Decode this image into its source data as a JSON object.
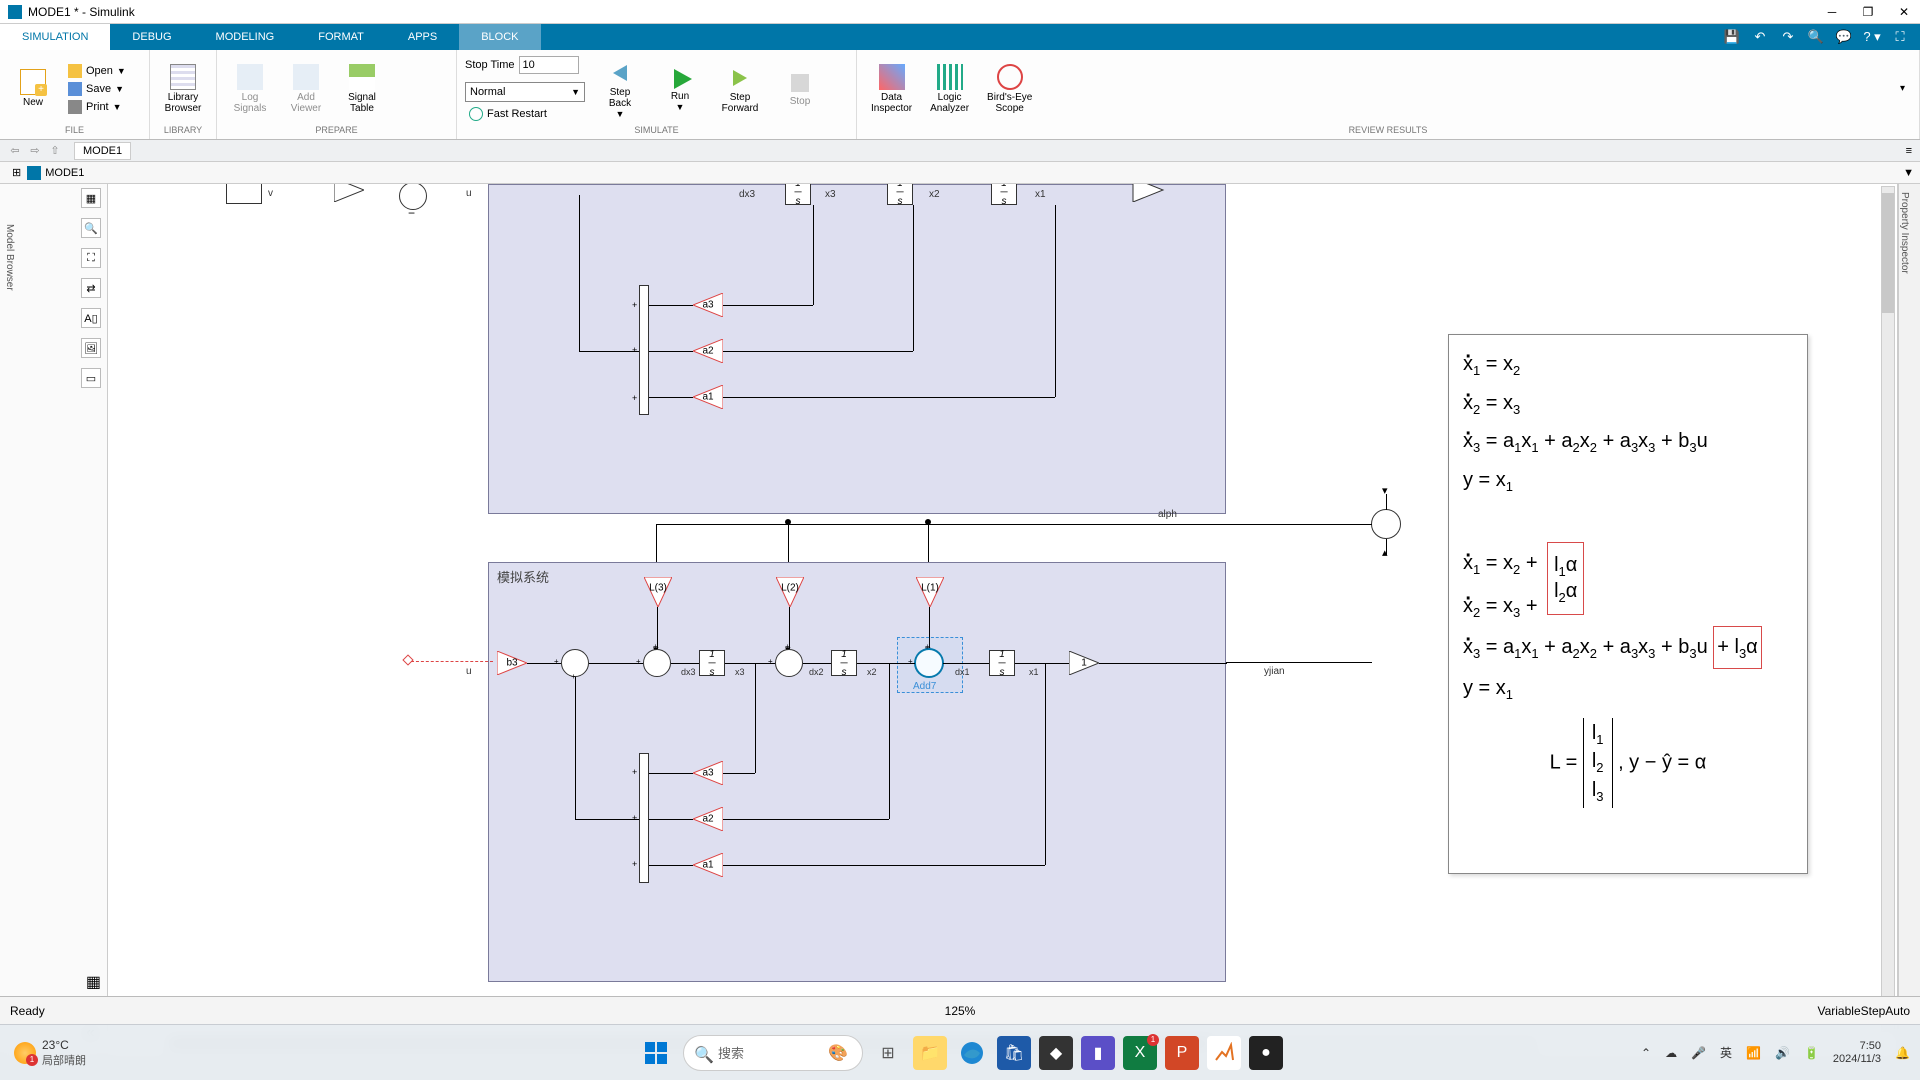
{
  "window": {
    "title": "MODE1 * - Simulink"
  },
  "tabs": {
    "simulation": "SIMULATION",
    "debug": "DEBUG",
    "modeling": "MODELING",
    "format": "FORMAT",
    "apps": "APPS",
    "block": "BLOCK"
  },
  "toolstrip": {
    "new": "New",
    "open": "Open",
    "save": "Save",
    "print": "Print",
    "library_browser": "Library\nBrowser",
    "log_signals": "Log\nSignals",
    "add_viewer": "Add\nViewer",
    "signal_table": "Signal\nTable",
    "stop_time_label": "Stop Time",
    "stop_time_value": "10",
    "mode": "Normal",
    "fast_restart": "Fast Restart",
    "step_back": "Step\nBack",
    "run": "Run",
    "step_forward": "Step\nForward",
    "stop": "Stop",
    "data_inspector": "Data\nInspector",
    "logic_analyzer": "Logic\nAnalyzer",
    "birds_eye": "Bird's-Eye\nScope",
    "groups": {
      "file": "FILE",
      "library": "LIBRARY",
      "prepare": "PREPARE",
      "simulate": "SIMULATE",
      "review": "REVIEW RESULTS"
    }
  },
  "explorer": {
    "model": "MODE1"
  },
  "tab_current": "MODE1",
  "sidebar_label": "Model Browser",
  "right_panel": "Property Inspector",
  "canvas": {
    "subsystem2_label": "模拟系统",
    "gains": {
      "b3": "b3",
      "a1": "a1",
      "a2": "a2",
      "a3": "a3",
      "L1": "L(1)",
      "L2": "L(2)",
      "L3": "L(3)",
      "one": "1"
    },
    "signals": {
      "u": "u",
      "v": "v",
      "dx3": "dx3",
      "x3": "x3",
      "dx2": "dx2",
      "x2": "x2",
      "dx1": "dx1",
      "x1": "x1",
      "alph": "alph",
      "yjian": "yjian"
    },
    "selected_block": "Add7",
    "integrator_sym": "1/s"
  },
  "annotation": {
    "eq1": "ẋ₁ = x₂",
    "eq2": "ẋ₂ = x₃",
    "eq3": "ẋ₃ = a₁x₁ + a₂x₂ + a₃x₃ + b₃u",
    "eq4": "y = x₁",
    "eq5a": "ẋ₁ = x₂ +",
    "eq5b": "l₁α",
    "eq6a": "ẋ₂ = x₃ +",
    "eq6b": "l₂α",
    "eq7a": "ẋ₃ = a₁x₁ + a₂x₂ + a₃x₃ + b₃u",
    "eq7b": "+ l₃α",
    "eq8": "y = x₁",
    "matL": "L =",
    "mat1": "l₁",
    "mat2": "l₂",
    "mat3": "l₃",
    "matR": ", y − ŷ = α"
  },
  "status": {
    "ready": "Ready",
    "zoom": "125%",
    "solver": "VariableStepAuto"
  },
  "taskbar": {
    "search_placeholder": "搜索",
    "temp": "23°C",
    "weather_desc": "局部晴朗",
    "ime": "英",
    "time": "7:50",
    "date": "2024/11/3",
    "alert_count": "1"
  }
}
